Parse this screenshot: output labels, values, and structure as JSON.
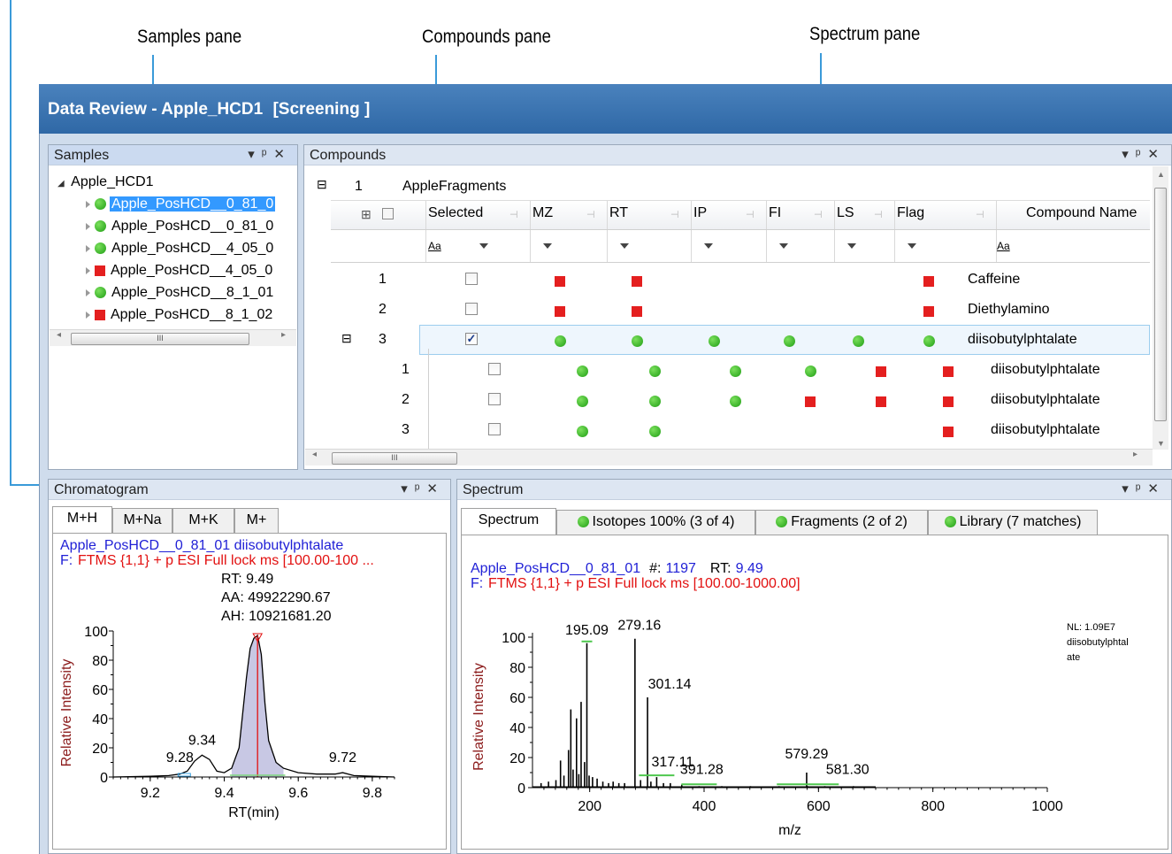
{
  "callouts": {
    "samples_pane": "Samples pane",
    "compounds_pane": "Compounds pane",
    "spectrum_pane": "Spectrum pane"
  },
  "window": {
    "title": "Data Review - Apple_HCD1",
    "mode": "[Screening ]"
  },
  "samples": {
    "title": "Samples",
    "root": "Apple_HCD1",
    "items": [
      {
        "label": "Apple_PosHCD__0_81_0",
        "status": "green",
        "selected": true
      },
      {
        "label": "Apple_PosHCD__0_81_0",
        "status": "green",
        "selected": false
      },
      {
        "label": "Apple_PosHCD__4_05_0",
        "status": "green",
        "selected": false
      },
      {
        "label": "Apple_PosHCD__4_05_0",
        "status": "red",
        "selected": false
      },
      {
        "label": "Apple_PosHCD__8_1_01",
        "status": "green",
        "selected": false
      },
      {
        "label": "Apple_PosHCD__8_1_02",
        "status": "red",
        "selected": false
      }
    ],
    "scroll_grip": "III"
  },
  "compounds": {
    "title": "Compounds",
    "group_number": "1",
    "group_name": "AppleFragments",
    "columns": [
      "Selected",
      "MZ",
      "RT",
      "IP",
      "FI",
      "LS",
      "Flag",
      "Compound Name"
    ],
    "filter_aa": "Aa",
    "rows": [
      {
        "num": "1",
        "checked": false,
        "marks": [
          "red",
          "red",
          "",
          "",
          "",
          "red"
        ],
        "name": "Caffeine"
      },
      {
        "num": "2",
        "checked": false,
        "marks": [
          "red",
          "red",
          "",
          "",
          "",
          "red"
        ],
        "name": "Diethylamino"
      },
      {
        "num": "3",
        "checked": true,
        "marks": [
          "green",
          "green",
          "green",
          "green",
          "green",
          "green"
        ],
        "name": "diisobutylphtalate"
      }
    ],
    "subrows": [
      {
        "num": "1",
        "checked": false,
        "marks": [
          "green",
          "green",
          "green",
          "green",
          "red",
          "red"
        ],
        "name": "diisobutylphtalate"
      },
      {
        "num": "2",
        "checked": false,
        "marks": [
          "green",
          "green",
          "green",
          "red",
          "red",
          "red"
        ],
        "name": "diisobutylphtalate"
      },
      {
        "num": "3",
        "checked": false,
        "marks": [
          "green",
          "green",
          "",
          "",
          "",
          "red"
        ],
        "name": "diisobutylphtalate"
      }
    ],
    "scroll_grip": "III"
  },
  "chromatogram": {
    "title": "Chromatogram",
    "tabs": [
      "M+H",
      "M+Na",
      "M+K",
      "M+"
    ],
    "header_line1": "Apple_PosHCD__0_81_01   diisobutylphtalate",
    "header_prefix": "F:",
    "header_line2": "FTMS {1,1}  + p ESI Full lock ms [100.00-100 ...",
    "rt_label": "RT: 9.49",
    "aa_label": "AA: 49922290.67",
    "ah_label": "AH: 10921681.20",
    "peak_labels": [
      "9.28",
      "9.34",
      "9.72"
    ],
    "xlabel": "RT(min)",
    "ylabel": "Relative Intensity",
    "x_ticks": [
      "9.2",
      "9.4",
      "9.6",
      "9.8"
    ],
    "y_ticks": [
      "0",
      "20",
      "40",
      "60",
      "80",
      "100"
    ]
  },
  "spectrum": {
    "title": "Spectrum",
    "tabs": [
      "Spectrum",
      "Isotopes 100% (3 of 4)",
      "Fragments (2 of 2)",
      "Library (7 matches)"
    ],
    "header_sample": "Apple_PosHCD__0_81_01",
    "header_scan_label": "#:",
    "header_scan": "1197",
    "header_rt_label": "RT:",
    "header_rt": "9.49",
    "header_prefix": "F:",
    "header_line2": "FTMS {1,1}  + p ESI Full lock ms [100.00-1000.00]",
    "nl_label": "NL: 1.09E7",
    "compound_line1": "diisobutylphtal",
    "compound_line2": "ate",
    "xlabel": "m/z",
    "ylabel": "Relative Intensity",
    "x_ticks": [
      "200",
      "400",
      "600",
      "800",
      "1000"
    ],
    "y_ticks": [
      "0",
      "20",
      "40",
      "60",
      "80",
      "100"
    ],
    "peak_labels": [
      "195.09",
      "279.16",
      "301.14",
      "317.11",
      "391.28",
      "579.29",
      "581.30"
    ]
  },
  "chart_data": [
    {
      "type": "line",
      "title": "",
      "xlabel": "RT(min)",
      "ylabel": "Relative Intensity",
      "xlim": [
        9.1,
        9.86
      ],
      "ylim": [
        0,
        100
      ],
      "annotations": [
        "RT: 9.49",
        "AA: 49922290.67",
        "AH: 10921681.20",
        "9.28",
        "9.34",
        "9.72"
      ],
      "series": [
        {
          "x": [
            9.1,
            9.2,
            9.25,
            9.28,
            9.3,
            9.32,
            9.34,
            9.36,
            9.38,
            9.4,
            9.42,
            9.44,
            9.46,
            9.47,
            9.48,
            9.49,
            9.5,
            9.51,
            9.52,
            9.54,
            9.56,
            9.6,
            9.65,
            9.7,
            9.72,
            9.75,
            9.8,
            9.86
          ],
          "y": [
            0,
            0.5,
            1,
            2,
            4,
            11,
            15,
            12,
            4,
            3,
            6,
            20,
            68,
            88,
            95,
            97,
            84,
            50,
            25,
            10,
            6,
            3,
            2,
            2,
            3,
            1,
            0.5,
            0
          ]
        }
      ]
    },
    {
      "type": "bar",
      "title": "",
      "xlabel": "m/z",
      "ylabel": "Relative Intensity",
      "xlim": [
        100,
        1000
      ],
      "ylim": [
        0,
        100
      ],
      "annotations": [
        "NL: 1.09E7",
        "diisobutylphtalate"
      ],
      "x": [
        115,
        128,
        141,
        149,
        155,
        163,
        167,
        171,
        177,
        181,
        185,
        191,
        195.09,
        199,
        205,
        213,
        223,
        233,
        241,
        251,
        261,
        279.16,
        289,
        301.14,
        307,
        317.11,
        329,
        341,
        361,
        391.28,
        431,
        481,
        531,
        579.29,
        581.3,
        611,
        661
      ],
      "y": [
        3,
        4,
        5,
        18,
        8,
        25,
        52,
        12,
        46,
        9,
        57,
        17,
        96,
        8,
        7,
        6,
        4,
        3,
        4,
        3,
        3,
        99,
        5,
        60,
        4,
        7,
        3,
        3,
        2,
        1,
        1,
        1,
        1,
        10,
        1,
        1,
        1
      ]
    }
  ]
}
